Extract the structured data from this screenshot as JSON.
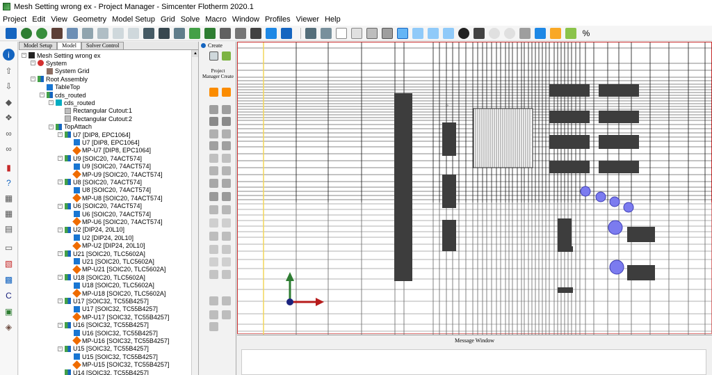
{
  "window": {
    "title": "Mesh Setting wrong ex - Project Manager - Simcenter Flotherm 2020.1"
  },
  "menu": [
    "Project",
    "Edit",
    "View",
    "Geometry",
    "Model Setup",
    "Grid",
    "Solve",
    "Macro",
    "Window",
    "Profiles",
    "Viewer",
    "Help"
  ],
  "tree_tabs": [
    "Model Setup",
    "Model",
    "Solver Control"
  ],
  "tree": [
    {
      "label": "Mesh Setting wrong ex",
      "icon": "root"
    },
    {
      "label": "System",
      "icon": "system"
    },
    {
      "label": "System Grid",
      "icon": "grid"
    },
    {
      "label": "Root Assembly",
      "icon": "assembly"
    },
    {
      "label": "TableTop",
      "icon": "cuboid"
    },
    {
      "label": "cds_routed",
      "icon": "assembly"
    },
    {
      "label": "cds_routed",
      "icon": "part"
    },
    {
      "label": "Rectangular Cutout:1",
      "icon": "cutout"
    },
    {
      "label": "Rectangular Cutout:2",
      "icon": "cutout"
    },
    {
      "label": "TopAttach",
      "icon": "assembly"
    },
    {
      "label": "U7 [DIP8, EPC1064]",
      "icon": "assembly"
    },
    {
      "label": "U7 [DIP8, EPC1064]",
      "icon": "cuboid"
    },
    {
      "label": "MP-U7 [DIP8, EPC1064]",
      "icon": "mp"
    },
    {
      "label": "U9 [SOIC20, 74ACT574]",
      "icon": "assembly"
    },
    {
      "label": "U9 [SOIC20, 74ACT574]",
      "icon": "cuboid"
    },
    {
      "label": "MP-U9 [SOIC20, 74ACT574]",
      "icon": "mp"
    },
    {
      "label": "U8 [SOIC20, 74ACT574]",
      "icon": "assembly"
    },
    {
      "label": "U8 [SOIC20, 74ACT574]",
      "icon": "cuboid"
    },
    {
      "label": "MP-U8 [SOIC20, 74ACT574]",
      "icon": "mp"
    },
    {
      "label": "U6 [SOIC20, 74ACT574]",
      "icon": "assembly"
    },
    {
      "label": "U6 [SOIC20, 74ACT574]",
      "icon": "cuboid"
    },
    {
      "label": "MP-U6 [SOIC20, 74ACT574]",
      "icon": "mp"
    },
    {
      "label": "U2 [DIP24, 20L10]",
      "icon": "assembly"
    },
    {
      "label": "U2 [DIP24, 20L10]",
      "icon": "cuboid"
    },
    {
      "label": "MP-U2 [DIP24, 20L10]",
      "icon": "mp"
    },
    {
      "label": "U21 [SOIC20, TLC5602A]",
      "icon": "assembly"
    },
    {
      "label": "U21 [SOIC20, TLC5602A]",
      "icon": "cuboid"
    },
    {
      "label": "MP-U21 [SOIC20, TLC5602A]",
      "icon": "mp"
    },
    {
      "label": "U18 [SOIC20, TLC5602A]",
      "icon": "assembly"
    },
    {
      "label": "U18 [SOIC20, TLC5602A]",
      "icon": "cuboid"
    },
    {
      "label": "MP-U18 [SOIC20, TLC5602A]",
      "icon": "mp"
    },
    {
      "label": "U17 [SOIC32, TC55B4257]",
      "icon": "assembly"
    },
    {
      "label": "U17 [SOIC32, TC55B4257]",
      "icon": "cuboid"
    },
    {
      "label": "MP-U17 [SOIC32, TC55B4257]",
      "icon": "mp"
    },
    {
      "label": "U16 [SOIC32, TC55B4257]",
      "icon": "assembly"
    },
    {
      "label": "U16 [SOIC32, TC55B4257]",
      "icon": "cuboid"
    },
    {
      "label": "MP-U16 [SOIC32, TC55B4257]",
      "icon": "mp"
    },
    {
      "label": "U15 [SOIC32, TC55B4257]",
      "icon": "assembly"
    },
    {
      "label": "U15 [SOIC32, TC55B4257]",
      "icon": "cuboid"
    },
    {
      "label": "MP-U15 [SOIC32, TC55B4257]",
      "icon": "mp"
    },
    {
      "label": "U14 [SOIC32, TC55B4257]",
      "icon": "assembly"
    }
  ],
  "palette": {
    "header": "Create",
    "panel_label": "Project Manager Create"
  },
  "message_window": {
    "title": "Message Window"
  },
  "colors": {
    "viewport_border": "#c62828",
    "component_fill": "#3d3d3d",
    "grid_line": "#111111",
    "monitor_point": "#7b7bef"
  }
}
